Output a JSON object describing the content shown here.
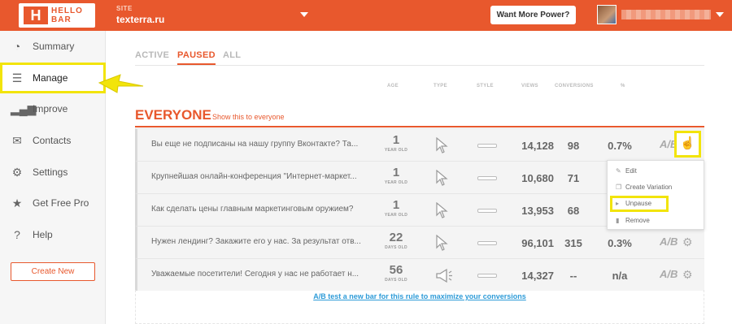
{
  "header": {
    "logo_text": "HELLO BAR",
    "logo_mark": "H",
    "site_label": "SITE",
    "site_name": "texterra.ru",
    "power_button": "Want More Power?",
    "user_name": " "
  },
  "sidebar": {
    "items": [
      {
        "label": "Summary",
        "icon": "gauge-icon"
      },
      {
        "label": "Manage",
        "icon": "list-icon"
      },
      {
        "label": "Improve",
        "icon": "bar-chart-icon"
      },
      {
        "label": "Contacts",
        "icon": "envelope-icon"
      },
      {
        "label": "Settings",
        "icon": "gear-icon"
      },
      {
        "label": "Get Free Pro",
        "icon": "star-icon"
      },
      {
        "label": "Help",
        "icon": "question-icon"
      }
    ],
    "active": "Manage",
    "create_button": "Create New"
  },
  "tabs": [
    {
      "label": "ACTIVE"
    },
    {
      "label": "PAUSED",
      "active": true
    },
    {
      "label": "ALL"
    }
  ],
  "columns": {
    "age": "AGE",
    "type": "TYPE",
    "style": "STYLE",
    "views": "VIEWS",
    "conversions": "CONVERSIONS",
    "pct": "%"
  },
  "rule": {
    "title": "EVERYONE",
    "subtitle": "Show this to everyone"
  },
  "rows": [
    {
      "message": "Вы еще не подписаны на нашу группу Вконтакте? Та...",
      "age": "1",
      "age_unit": "YEAR OLD",
      "type": "pointer",
      "views": "14,128",
      "conversions": "98",
      "pct": "0.7%"
    },
    {
      "message": "Крупнейшая онлайн-конференция \"Интернет-маркет...",
      "age": "1",
      "age_unit": "YEAR OLD",
      "type": "pointer",
      "views": "10,680",
      "conversions": "71",
      "pct": ""
    },
    {
      "message": "Как сделать цены главным маркетинговым оружием?",
      "age": "1",
      "age_unit": "YEAR OLD",
      "type": "pointer",
      "views": "13,953",
      "conversions": "68",
      "pct": ""
    },
    {
      "message": "Нужен лендинг? Закажите его у нас. За результат отв...",
      "age": "22",
      "age_unit": "DAYS OLD",
      "type": "pointer",
      "views": "96,101",
      "conversions": "315",
      "pct": "0.3%"
    },
    {
      "message": "Уважаемые посетители! Сегодня у нас не работает н...",
      "age": "56",
      "age_unit": "DAYS OLD",
      "type": "megaphone",
      "views": "14,327",
      "conversions": "--",
      "pct": "n/a"
    }
  ],
  "ab_icon_text": "A/B",
  "menu": {
    "items": [
      {
        "label": "Edit",
        "icon": "pencil-icon"
      },
      {
        "label": "Create Variation",
        "icon": "copy-icon"
      },
      {
        "label": "Unpause",
        "icon": "play-icon",
        "highlighted": true
      },
      {
        "label": "Remove",
        "icon": "trash-icon"
      }
    ]
  },
  "ab_test_link": "A/B test a new bar for this rule to maximize your conversions",
  "colors": {
    "brand": "#e8582d",
    "highlight": "#f2e40a",
    "link": "#2d9bd8"
  }
}
